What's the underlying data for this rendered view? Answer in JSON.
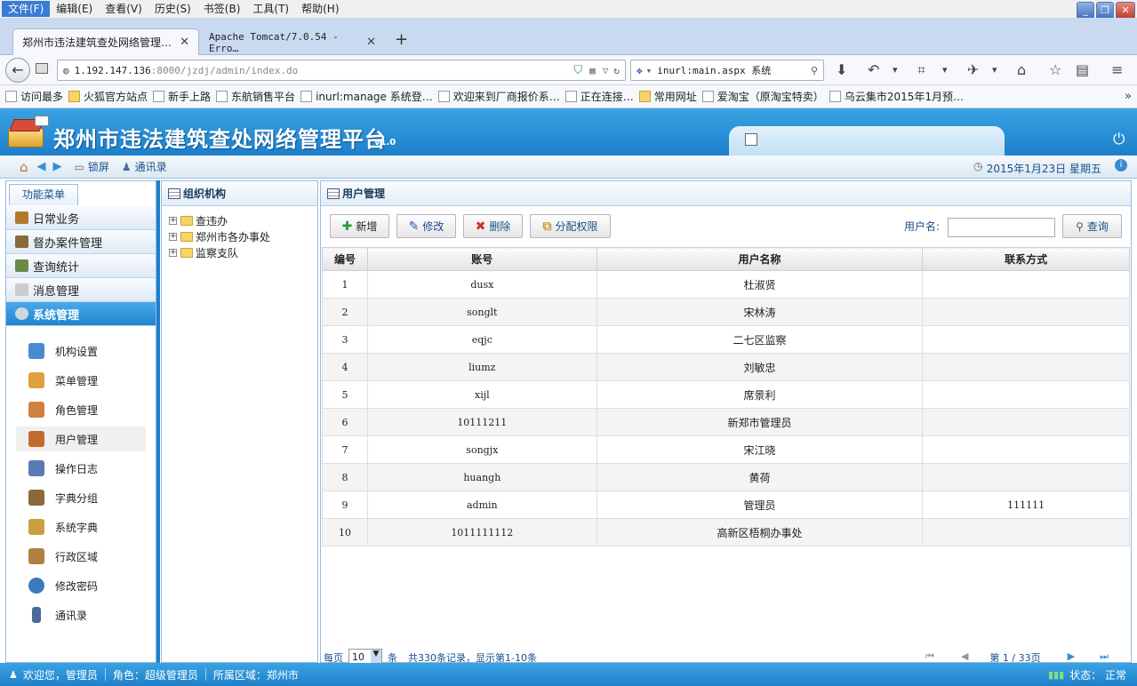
{
  "browser": {
    "menu": [
      "文件(F)",
      "编辑(E)",
      "查看(V)",
      "历史(S)",
      "书签(B)",
      "工具(T)",
      "帮助(H)"
    ],
    "tabs": [
      {
        "label": "郑州市违法建筑查处网络管理…"
      },
      {
        "label": "Apache Tomcat/7.0.54 - Erro…"
      }
    ],
    "url_host": "1.192.147.136",
    "url_rest": ":8000/jzdj/admin/index.do",
    "search_value": "inurl:main.aspx 系统",
    "bookmarks": [
      {
        "label": "访问最多",
        "icon": "search-icon"
      },
      {
        "label": "火狐官方站点",
        "icon": "folder-icon"
      },
      {
        "label": "新手上路",
        "icon": "page-icon"
      },
      {
        "label": "东航销售平台",
        "icon": "airline-icon"
      },
      {
        "label": "inurl:manage 系统登…",
        "icon": "paw-icon"
      },
      {
        "label": "欢迎来到厂商报价系…",
        "icon": "page-icon"
      },
      {
        "label": "正在连接…",
        "icon": "page-icon"
      },
      {
        "label": "常用网址",
        "icon": "folder-icon"
      },
      {
        "label": "爱淘宝（原淘宝特卖）",
        "icon": "taobao-icon"
      },
      {
        "label": "乌云集市2015年1月预…",
        "icon": "wooyun-icon"
      }
    ]
  },
  "app": {
    "title": "郑州市违法建筑查处网络管理平台",
    "version": "v1.0",
    "toolbar": {
      "lock": "锁屏",
      "contacts": "通讯录"
    },
    "date": "2015年1月23日 星期五",
    "sidebar": {
      "tab": "功能菜单",
      "headers": [
        {
          "label": "日常业务",
          "color": "#b07a2a"
        },
        {
          "label": "督办案件管理",
          "color": "#8a6a3a"
        },
        {
          "label": "查询统计",
          "color": "#6a8a4a"
        },
        {
          "label": "消息管理",
          "color": "#aaaaaa"
        },
        {
          "label": "系统管理",
          "color": "#cfd8e0"
        }
      ],
      "items": [
        {
          "label": "机构设置",
          "color": "#4a8ad0"
        },
        {
          "label": "菜单管理",
          "color": "#e0a040"
        },
        {
          "label": "角色管理",
          "color": "#d08040"
        },
        {
          "label": "用户管理",
          "color": "#c06a30"
        },
        {
          "label": "操作日志",
          "color": "#5a7ab0"
        },
        {
          "label": "字典分组",
          "color": "#8a6a3a"
        },
        {
          "label": "系统字典",
          "color": "#c9a040"
        },
        {
          "label": "行政区域",
          "color": "#b08040"
        },
        {
          "label": "修改密码",
          "color": "#3a7ac0"
        },
        {
          "label": "通讯录",
          "color": "#4a6a9a"
        }
      ]
    },
    "org": {
      "title": "组织机构",
      "nodes": [
        "查违办",
        "郑州市各办事处",
        "监察支队"
      ]
    },
    "users": {
      "title": "用户管理",
      "buttons": {
        "add": "新增",
        "edit": "修改",
        "delete": "删除",
        "assign": "分配权限"
      },
      "search_label": "用户名:",
      "search_button": "查询",
      "columns": [
        "编号",
        "账号",
        "用户名称",
        "联系方式"
      ],
      "rows": [
        [
          "1",
          "dusx",
          "杜淑贤",
          ""
        ],
        [
          "2",
          "songlt",
          "宋林涛",
          ""
        ],
        [
          "3",
          "eqjc",
          "二七区监察",
          ""
        ],
        [
          "4",
          "liumz",
          "刘敏忠",
          ""
        ],
        [
          "5",
          "xijl",
          "席景利",
          ""
        ],
        [
          "6",
          "10111211",
          "新郑市管理员",
          ""
        ],
        [
          "7",
          "songjx",
          "宋江晓",
          ""
        ],
        [
          "8",
          "huangh",
          "黄荷",
          ""
        ],
        [
          "9",
          "admin",
          "管理员",
          "111111"
        ],
        [
          "10",
          "1011111112",
          "高新区梧桐办事处",
          ""
        ]
      ],
      "pager": {
        "per_page": "每页",
        "size": "10",
        "unit": "条",
        "summary": "共330条记录，显示第1-10条",
        "page_info": "第 1 / 33页"
      }
    },
    "status": {
      "welcome": "欢迎您，管理员",
      "role": "角色：超级管理员",
      "region": "所属区域：郑州市",
      "state": "状态： 正常"
    }
  }
}
